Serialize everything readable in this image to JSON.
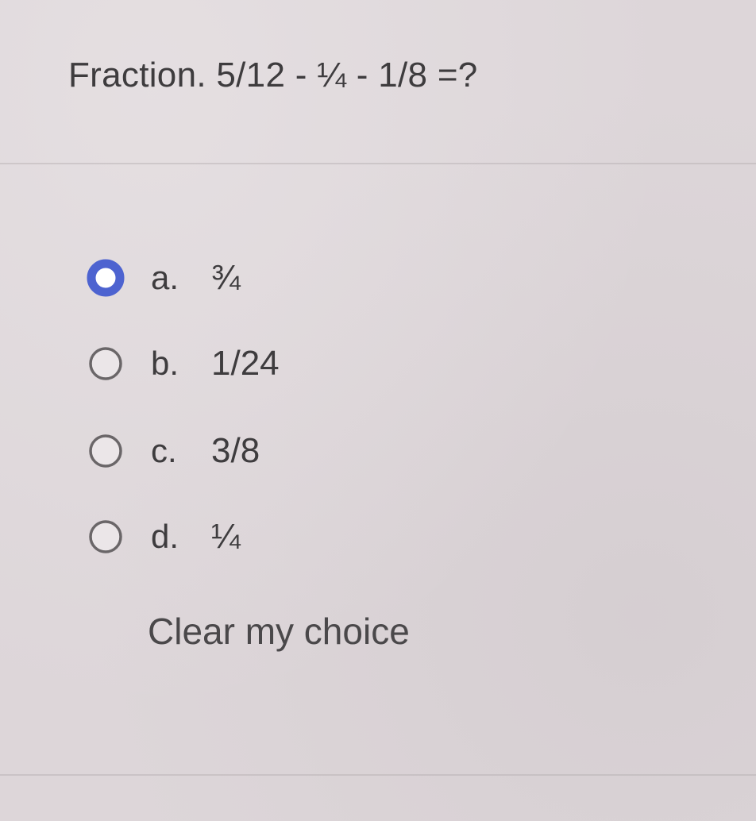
{
  "question": {
    "text": "Fraction. 5/12 - ¼ - 1/8 =?"
  },
  "answers": {
    "options": [
      {
        "letter": "a.",
        "value": "¾",
        "selected": true
      },
      {
        "letter": "b.",
        "value": "1/24",
        "selected": false
      },
      {
        "letter": "c.",
        "value": "3/8",
        "selected": false
      },
      {
        "letter": "d.",
        "value": "¼",
        "selected": false
      }
    ]
  },
  "clear_choice": {
    "label": "Clear my choice"
  },
  "colors": {
    "accent": "#4d63d0",
    "radio_border": "#6a6668",
    "background": "#ddd6d9",
    "text": "#3e3c3e"
  },
  "icons": {
    "selected": "radio-selected-icon",
    "unselected": "radio-unselected-icon"
  }
}
